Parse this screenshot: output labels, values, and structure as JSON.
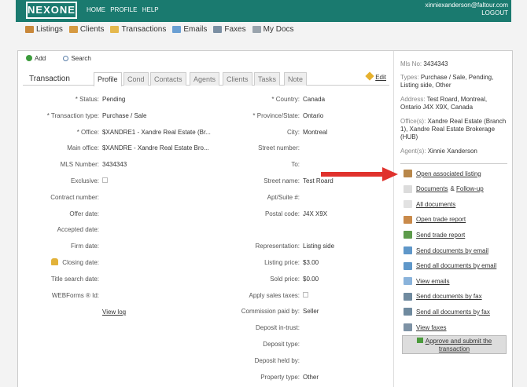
{
  "header": {
    "logo": "NEXONE",
    "nav": [
      "HOME",
      "PROFILE",
      "HELP"
    ],
    "user_email": "xinniexanderson@faltour.com",
    "logout": "LOGOUT"
  },
  "modules": [
    {
      "label": "Listings",
      "icon": "house-icon",
      "color": "#c9883a"
    },
    {
      "label": "Clients",
      "icon": "people-icon",
      "color": "#d69a42"
    },
    {
      "label": "Transactions",
      "icon": "folder-icon",
      "color": "#e5b84d"
    },
    {
      "label": "Emails",
      "icon": "envelope-icon",
      "color": "#6a9fd3"
    },
    {
      "label": "Faxes",
      "icon": "fax-icon",
      "color": "#7b8fa3"
    },
    {
      "label": "My Docs",
      "icon": "docs-icon",
      "color": "#9aa4ad"
    }
  ],
  "toolbar": {
    "add": "Add",
    "search": "Search"
  },
  "tabs": {
    "title": "Transaction",
    "items": [
      "Profile",
      "Cond",
      "Contacts",
      "Agents",
      "Clients",
      "Tasks",
      "Note"
    ],
    "active": "Profile",
    "edit": "Edit"
  },
  "left_fields": [
    {
      "label": "* Status:",
      "value": "Pending"
    },
    {
      "label": "* Transaction type:",
      "value": "Purchase / Sale"
    },
    {
      "label": "* Office:",
      "value": "$XANDRE1 - Xandre Real Estate (Br..."
    },
    {
      "label": "Main office:",
      "value": "$XANDRE - Xandre Real Estate Bro..."
    },
    {
      "label": "MLS Number:",
      "value": "3434343"
    },
    {
      "label": "Exclusive:",
      "value": ""
    },
    {
      "label": "Contract number:",
      "value": ""
    },
    {
      "label": "Offer date:",
      "value": ""
    },
    {
      "label": "Accepted date:",
      "value": ""
    },
    {
      "label": "Firm date:",
      "value": ""
    },
    {
      "label": "Closing date:",
      "value": ""
    },
    {
      "label": "Title search date:",
      "value": ""
    },
    {
      "label": "WEBForms ® Id:",
      "value": ""
    }
  ],
  "view_log": "View log",
  "right_fields": [
    {
      "label": "* Country:",
      "value": "Canada"
    },
    {
      "label": "* Province/State:",
      "value": "Ontario"
    },
    {
      "label": "City:",
      "value": "Montreal"
    },
    {
      "label": "Street number:",
      "value": ""
    },
    {
      "label": "To:",
      "value": ""
    },
    {
      "label": "Street name:",
      "value": "Test Roard"
    },
    {
      "label": "Apt/Suite #:",
      "value": ""
    },
    {
      "label": "Postal code:",
      "value": "J4X X9X"
    },
    {
      "label": "",
      "value": ""
    },
    {
      "label": "Representation:",
      "value": "Listing side"
    },
    {
      "label": "Listing price:",
      "value": "$3.00"
    },
    {
      "label": "Sold price:",
      "value": "$0.00"
    },
    {
      "label": "Apply sales taxes:",
      "value": ""
    },
    {
      "label": "Commission paid by:",
      "value": "Seller"
    },
    {
      "label": "Deposit in-trust:",
      "value": ""
    },
    {
      "label": "Deposit type:",
      "value": ""
    },
    {
      "label": "Deposit held by:",
      "value": ""
    },
    {
      "label": "Property type:",
      "value": "Other"
    }
  ],
  "summary": {
    "mls_label": "Mls No:",
    "mls": "3434343",
    "types_label": "Types:",
    "types": "Purchase / Sale, Pending, Listing side, Other",
    "address_label": "Address:",
    "address": "Test Roard, Montreal, Ontario J4X X9X, Canada",
    "offices_label": "Office(s):",
    "offices": "Xandre Real Estate (Branch 1), Xandre Real Estate Brokerage (HUB)",
    "agents_label": "Agent(s):",
    "agents": "Xinnie Xanderson"
  },
  "actions": [
    {
      "label": "Open associated listing",
      "icon": "house-icon",
      "color": "#b8874a"
    },
    {
      "label": "Documents",
      "suffix": "& Follow-up",
      "icon": "document-icon",
      "color": "#dcdcdc"
    },
    {
      "label": "All documents",
      "icon": "documents-icon",
      "color": "#e2e2e2"
    },
    {
      "label": "Open trade report",
      "icon": "report-icon",
      "color": "#c98a4a"
    },
    {
      "label": "Send trade report",
      "icon": "send-report-icon",
      "color": "#5d9b4b"
    },
    {
      "label": "Send documents by email",
      "icon": "email-send-icon",
      "color": "#5f97c9"
    },
    {
      "label": "Send all documents by email",
      "icon": "email-send-all-icon",
      "color": "#5f97c9"
    },
    {
      "label": "View emails",
      "icon": "envelope-icon",
      "color": "#8ab3db"
    },
    {
      "label": "Send documents by fax",
      "icon": "fax-icon",
      "color": "#6f8a9f"
    },
    {
      "label": "Send all documents by fax",
      "icon": "fax-all-icon",
      "color": "#6f8a9f"
    },
    {
      "label": "View faxes",
      "icon": "fax-view-icon",
      "color": "#7d92a5"
    }
  ],
  "approve": {
    "line1": "Approve and submit the",
    "line2": "transaction"
  }
}
